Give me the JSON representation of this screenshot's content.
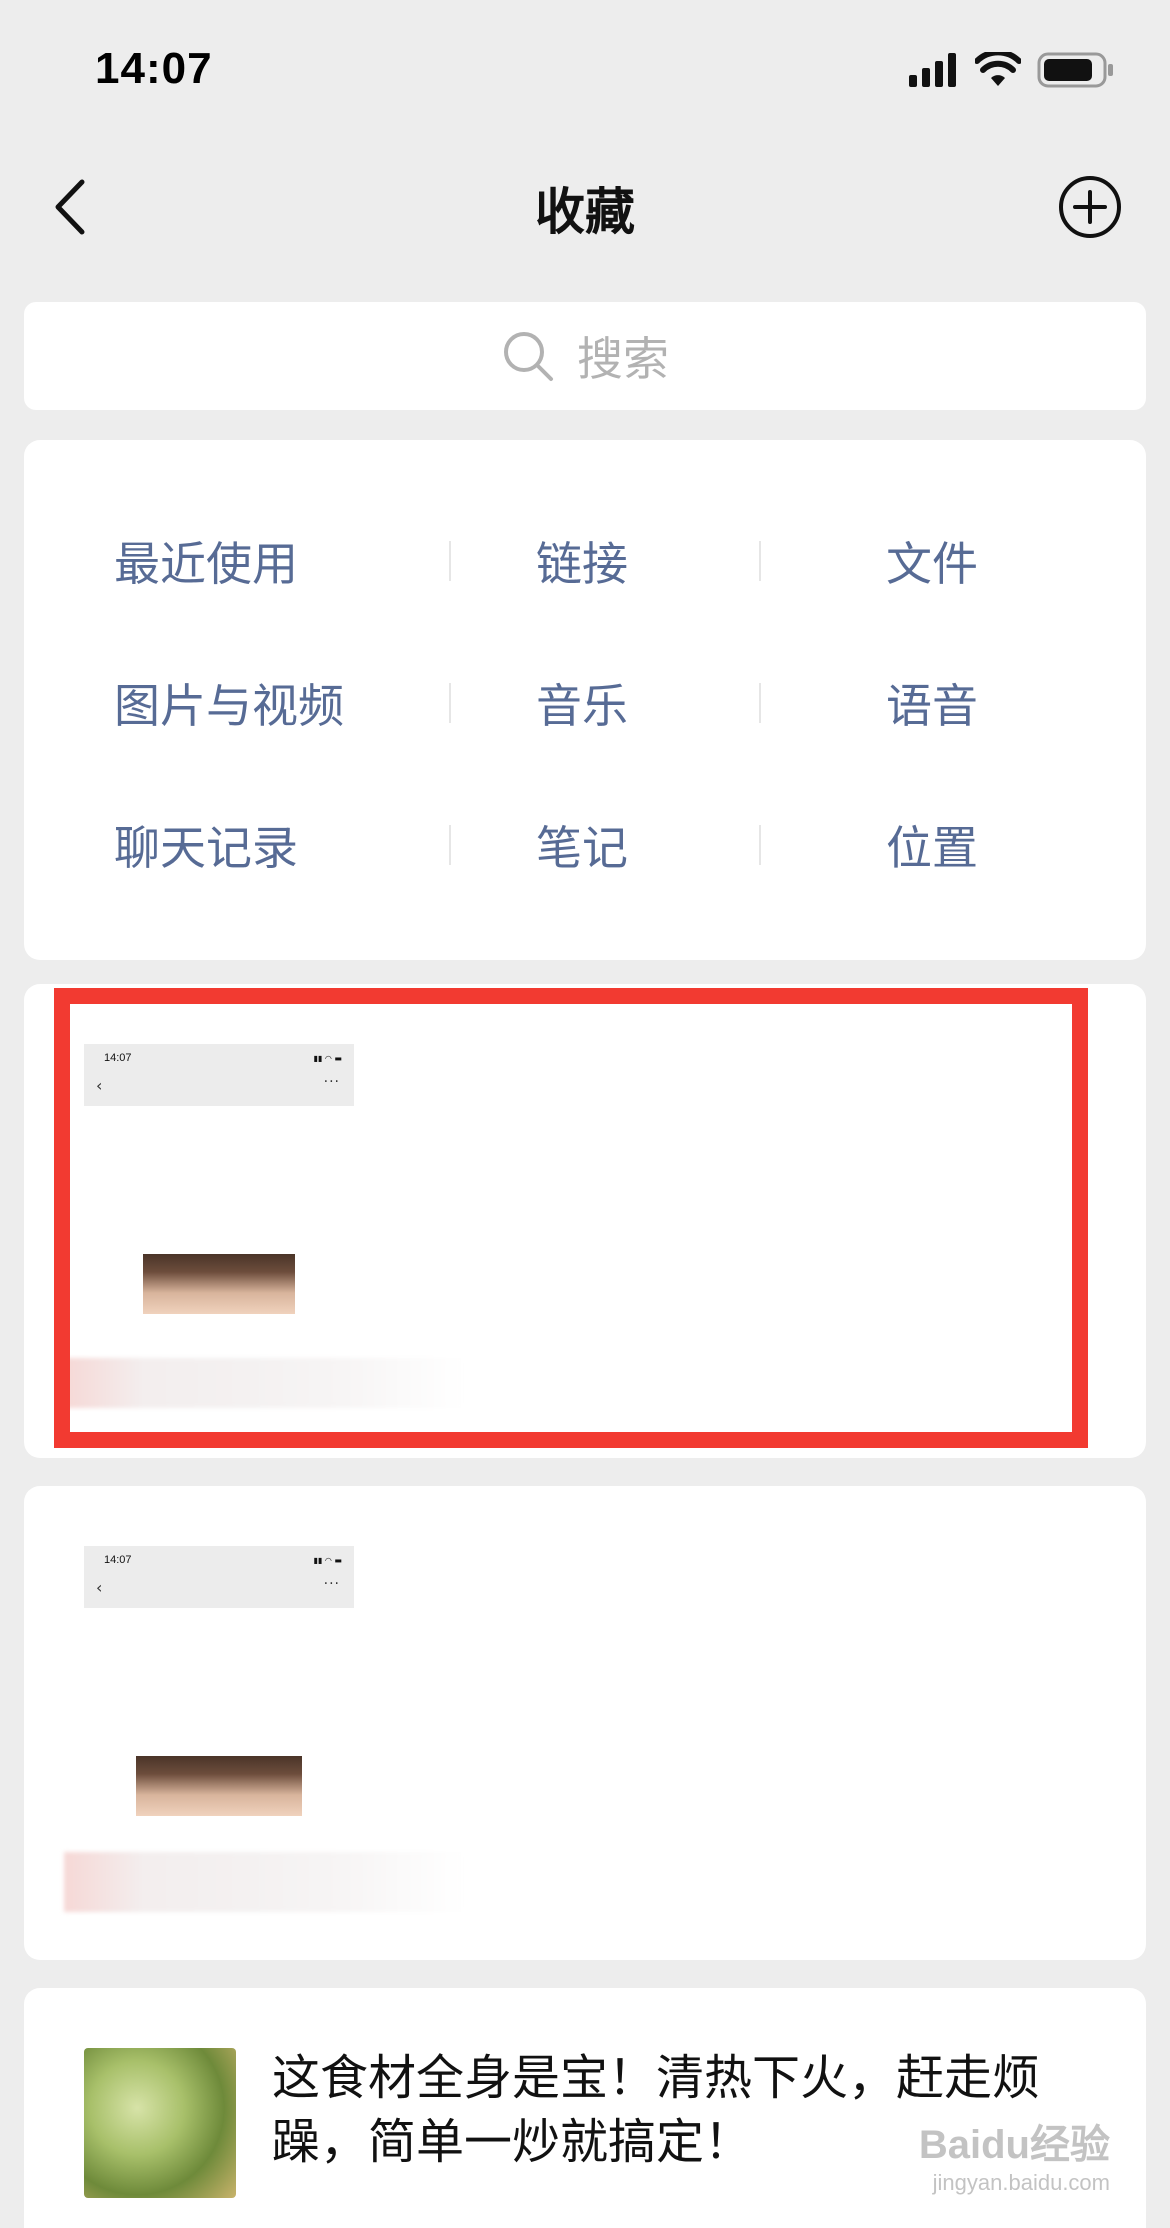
{
  "status_bar": {
    "time": "14:07"
  },
  "nav": {
    "title": "收藏"
  },
  "search": {
    "placeholder": "搜索"
  },
  "categories": [
    [
      "最近使用",
      "链接",
      "文件"
    ],
    [
      "图片与视频",
      "音乐",
      "语音"
    ],
    [
      "聊天记录",
      "笔记",
      "位置"
    ]
  ],
  "favorites": [
    {
      "mini_time": "14:07",
      "highlighted": true
    },
    {
      "mini_time": "14:07",
      "highlighted": false
    }
  ],
  "article": {
    "title": "这食材全身是宝！清热下火，赶走烦躁，简单一炒就搞定！"
  },
  "watermark": {
    "brand": "Baidu经验",
    "url": "jingyan.baidu.com"
  },
  "colors": {
    "accent_link": "#576b95",
    "highlight": "#f23a31",
    "background": "#ededed"
  }
}
